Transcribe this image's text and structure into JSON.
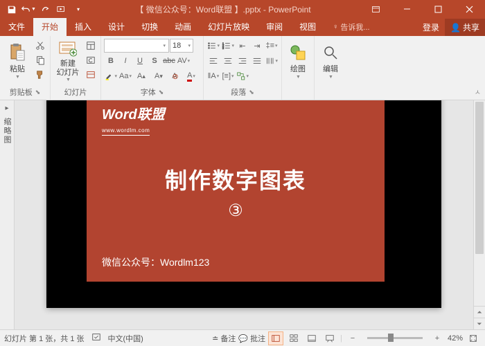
{
  "title_bar": "【 微信公众号：Word联盟 】.pptx - PowerPoint",
  "tabs": {
    "file": "文件",
    "home": "开始",
    "insert": "插入",
    "design": "设计",
    "transitions": "切换",
    "animations": "动画",
    "slideshow": "幻灯片放映",
    "review": "审阅",
    "view": "视图",
    "tell_me": "告诉我...",
    "login": "登录",
    "share": "共享"
  },
  "ribbon": {
    "paste": "粘贴",
    "clipboard": "剪贴板",
    "new_slide": "新建\n幻灯片",
    "slides": "幻灯片",
    "font_size": "18",
    "font_group": "字体",
    "paragraph": "段落",
    "drawing": "绘图",
    "editing": "编辑"
  },
  "thumb_label": "缩略图",
  "slide": {
    "brand": "Word联盟",
    "url": "www.wordlm.com",
    "heading": "制作数字图表",
    "number": "③",
    "footer": "微信公众号：Wordlm123"
  },
  "status": {
    "slide_info": "幻灯片 第 1 张，共 1 张",
    "lang": "中文(中国)",
    "notes": "备注",
    "comments": "批注",
    "zoom": "42%"
  }
}
